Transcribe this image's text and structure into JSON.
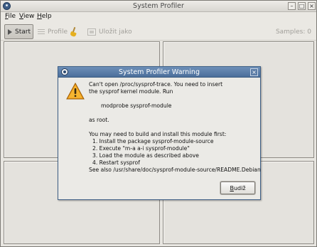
{
  "window": {
    "title": "System Profiler",
    "controls": {
      "minimize": "–",
      "maximize": "□",
      "close": "×"
    }
  },
  "menubar": {
    "items": [
      {
        "mnemonic": "F",
        "rest": "ile"
      },
      {
        "mnemonic": "V",
        "rest": "iew"
      },
      {
        "mnemonic": "H",
        "rest": "elp"
      }
    ]
  },
  "toolbar": {
    "start_label": "Start",
    "profile_label": "Profile",
    "save_label": "Uložit jako",
    "samples_text": "Samples: 0"
  },
  "dialog": {
    "title": "System Profiler Warning",
    "close_glyph": "×",
    "message": {
      "line1": "Can't open /proc/sysprof-trace. You need to insert",
      "line2": "the sysprof kernel module. Run",
      "command": "modprobe sysprof-module",
      "line3": "as root.",
      "line4": "You may need to build and install this module first:",
      "steps": [
        "1. Install the package sysprof-module-source",
        "2. Execute \"m-a a-i sysprof-module\"",
        "3. Load the module as described above",
        "4. Restart sysprof"
      ],
      "line5": "See also /usr/share/doc/sysprof-module-source/README.Debian"
    },
    "ok_button": {
      "mnemonic": "B",
      "rest": "udiž"
    }
  },
  "colors": {
    "dialog_titlebar": "#5a7ca8",
    "warning_fill": "#f0a020"
  }
}
